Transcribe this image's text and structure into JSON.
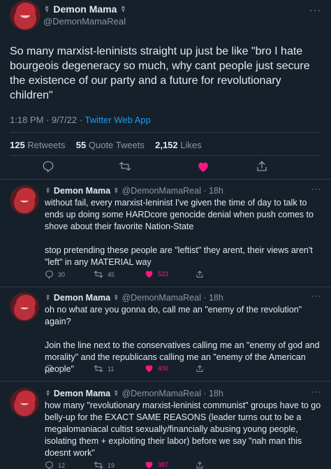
{
  "main_tweet": {
    "author_name": "☿ Demon Mama ☿",
    "author_handle": "@DemonMamaReal",
    "text": "So many marxist-leninists straight up just be like \"bro I hate bourgeois degeneracy so much, why cant people just secure the existence of our party and a future for revolutionary children\"",
    "time": "1:18 PM · 9/7/22 · ",
    "app": "Twitter Web App",
    "retweets": "125",
    "retweets_label": "Retweets",
    "quotes": "55",
    "quotes_label": "Quote Tweets",
    "likes": "2,152",
    "likes_label": "Likes",
    "more": "···"
  },
  "replies": [
    {
      "author_name": "☿ Demon Mama ☿",
      "meta": " @DemonMamaReal · 18h",
      "paragraphs": [
        "without fail, every marxist-leninist I've given the time of day to talk to ends up doing some HARDcore genocide denial when push comes to shove about their favorite Nation-State",
        "stop pretending these people are \"leftist\" they arent, their views aren't \"left\" in any MATERIAL way"
      ],
      "replies": "30",
      "retweets": "45",
      "likes": "523",
      "more": "···"
    },
    {
      "author_name": "☿ Demon Mama ☿",
      "meta": " @DemonMamaReal · 18h",
      "paragraphs": [
        "oh no what are you gonna do, call me an \"enemy of the revolution\" again?",
        "Join the line next to the conservatives calling me an \"enemy of god and morality\" and the republicans calling me an \"enemy of the American people\""
      ],
      "replies": "4",
      "retweets": "11",
      "likes": "400",
      "more": "···"
    },
    {
      "author_name": "☿ Demon Mama ☿",
      "meta": " @DemonMamaReal · 18h",
      "paragraphs": [
        "how many \"revolutionary marxist-leninist communist\" groups have to go belly-up for the EXACT SAME REASONS (leader turns out to be a megalomaniacal cultist sexually/financially abusing young people, isolating them + exploiting their labor) before we say \"nah man this doesnt work\""
      ],
      "replies": "12",
      "retweets": "19",
      "likes": "387",
      "more": "···"
    }
  ],
  "colors": {
    "background": "#15202b",
    "accent": "#1d9bf0",
    "like": "#f91880",
    "muted": "#8b98a5"
  }
}
